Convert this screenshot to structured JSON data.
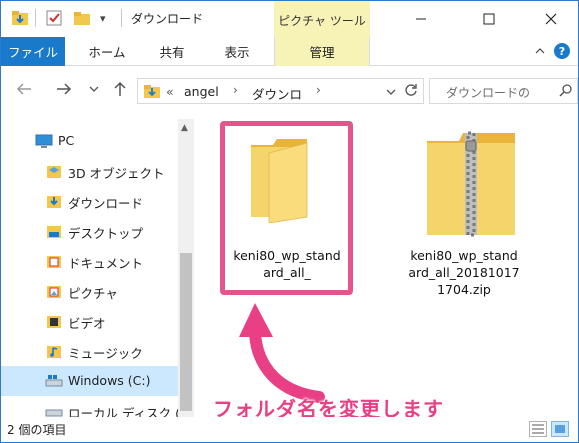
{
  "window": {
    "title": "ダウンロード",
    "context_tab_header": "ピクチャ ツール",
    "quick_access_dropdown": "▾"
  },
  "ribbon": {
    "tabs": [
      "ファイル",
      "ホーム",
      "共有",
      "表示",
      "管理"
    ],
    "help": "?"
  },
  "address": {
    "overflow": "«",
    "crumbs": [
      "angel",
      "ダウンロ"
    ],
    "search_placeholder": "ダウンロードの"
  },
  "nav_pane": {
    "items": [
      {
        "label": "PC",
        "icon": "pc-icon"
      },
      {
        "label": "3D オブジェクト",
        "icon": "3d-objects-icon"
      },
      {
        "label": "ダウンロード",
        "icon": "downloads-icon"
      },
      {
        "label": "デスクトップ",
        "icon": "desktop-icon"
      },
      {
        "label": "ドキュメント",
        "icon": "documents-icon"
      },
      {
        "label": "ピクチャ",
        "icon": "pictures-icon"
      },
      {
        "label": "ビデオ",
        "icon": "videos-icon"
      },
      {
        "label": "ミュージック",
        "icon": "music-icon"
      },
      {
        "label": "Windows (C:)",
        "icon": "drive-c-icon",
        "selected": true
      },
      {
        "label": "ローカル ディスク (D",
        "icon": "drive-d-icon"
      }
    ]
  },
  "files": [
    {
      "name_lines": [
        "keni80_wp_stand",
        "ard_all_"
      ],
      "type": "folder",
      "renaming": true
    },
    {
      "name_lines": [
        "keni80_wp_stand",
        "ard_all_20181017",
        "1704.zip"
      ],
      "type": "zip"
    }
  ],
  "annotation": {
    "text": "フォルダ名を変更します",
    "color": "#e93f84"
  },
  "status": {
    "item_count": "2 個の項目"
  },
  "colors": {
    "accent": "#1979ca",
    "context_tab": "#f7f2b5",
    "selection": "#cce8ff",
    "highlight": "#e4548d"
  }
}
